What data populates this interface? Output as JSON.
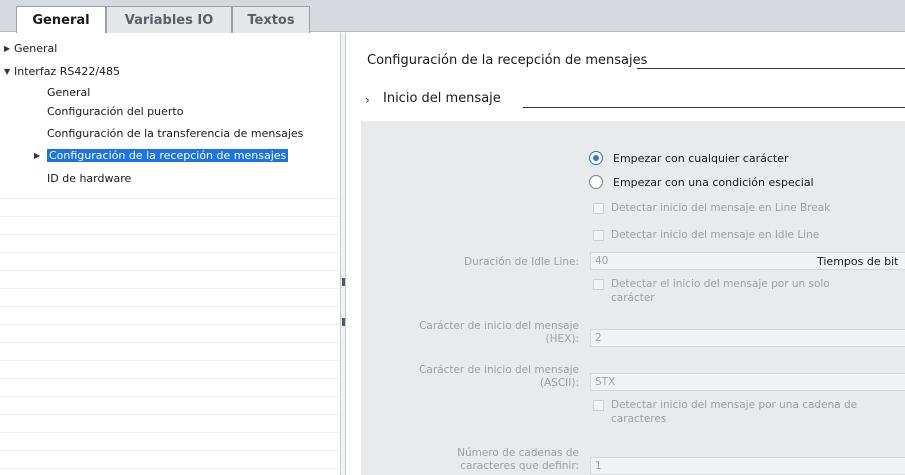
{
  "tabs": [
    {
      "label": "General",
      "active": true
    },
    {
      "label": "Variables IO",
      "active": false
    },
    {
      "label": "Textos",
      "active": false
    }
  ],
  "tree": {
    "items": [
      {
        "label": "General",
        "level": 0,
        "arrow": "▶"
      },
      {
        "label": "Interfaz RS422/485",
        "level": 0,
        "arrow": "▼"
      },
      {
        "label": "General",
        "level": 1
      },
      {
        "label": "Configuración del puerto",
        "level": 1
      },
      {
        "label": "Configuración de la transferencia de mensajes",
        "level": 1
      },
      {
        "label": "Configuración de la recepción de mensajes",
        "level": 1,
        "arrow": "▶",
        "selected": true
      },
      {
        "label": "ID de hardware",
        "level": 1
      }
    ],
    "selection_color": "#1a73e8"
  },
  "section": {
    "title": "Configuración de la recepción de mensajes",
    "subsection_title": "Inicio del mensaje"
  },
  "form": {
    "radio_any": "Empezar con cualquier carácter",
    "radio_special": "Empezar con una condición especial",
    "radio_selected": "any",
    "check_line_break": "Detectar inicio del mensaje en Line Break",
    "check_idle_line": "Detectar inicio del mensaje en Idle Line",
    "idle_label": "Duración de Idle Line:",
    "idle_value": "40",
    "idle_unit": "Tiempos de bit",
    "check_single_char_1": "Detectar el inicio del mensaje por un solo",
    "check_single_char_2": "carácter",
    "hex_label_1": "Carácter de inicio del mensaje",
    "hex_label_2": "(HEX):",
    "hex_value": "2",
    "ascii_label_1": "Carácter de inicio del mensaje",
    "ascii_label_2": "(ASCII):",
    "ascii_value": "STX",
    "check_string_1": "Detectar inicio del mensaje por una cadena de",
    "check_string_2": "caracteres",
    "num_label_1": "Número de cadenas de",
    "num_label_2": "caracteres que definir:",
    "num_value": "1"
  }
}
